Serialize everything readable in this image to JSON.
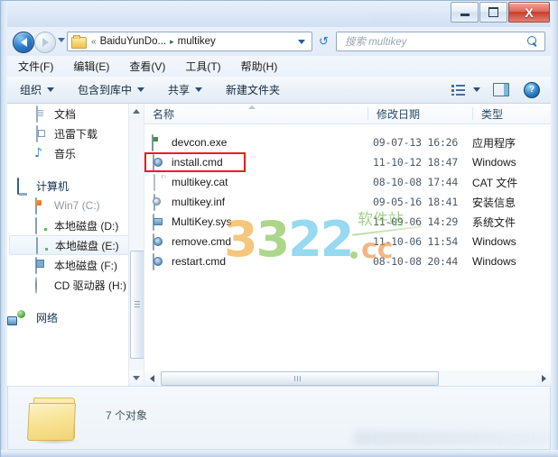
{
  "window": {
    "titlebar": {
      "minimize_label": "—",
      "maximize_label": "",
      "close_label": "X"
    }
  },
  "address_bar": {
    "folder_icon": "folder-icon",
    "overflow_chevron": "«",
    "crumbs": [
      "BaiduYunDo...",
      "multikey"
    ],
    "separator": "▸",
    "dropdown_icon": "chevron-down-icon",
    "refresh_icon": "refresh-icon",
    "back_icon": "back-arrow-icon",
    "forward_icon": "forward-arrow-icon"
  },
  "search": {
    "placeholder": "搜索 multikey",
    "icon": "search-icon"
  },
  "menubar": {
    "items": [
      {
        "label": "文件(F)"
      },
      {
        "label": "编辑(E)"
      },
      {
        "label": "查看(V)"
      },
      {
        "label": "工具(T)"
      },
      {
        "label": "帮助(H)"
      }
    ]
  },
  "commandbar": {
    "items": [
      {
        "label": "组织",
        "has_caret": true
      },
      {
        "label": "包含到库中",
        "has_caret": true
      },
      {
        "label": "共享",
        "has_caret": true
      },
      {
        "label": "新建文件夹",
        "has_caret": false
      }
    ],
    "views_icon": "view-layout-icon",
    "views_caret": "chevron-down-icon",
    "preview_pane_icon": "preview-pane-icon",
    "help_icon": "help-icon",
    "help_glyph": "?"
  },
  "navpane": {
    "groups": [
      {
        "items": [
          {
            "label": "文档",
            "icon": "document-icon",
            "state": "normal"
          },
          {
            "label": "迅雷下载",
            "icon": "download-folder-icon",
            "state": "normal"
          },
          {
            "label": "音乐",
            "icon": "music-icon",
            "state": "normal"
          }
        ]
      },
      {
        "root": {
          "label": "计算机",
          "icon": "computer-icon"
        },
        "items": [
          {
            "label": "Win7 (C:)",
            "icon": "windows-drive-icon",
            "state": "dim"
          },
          {
            "label": "本地磁盘 (D:)",
            "icon": "drive-icon",
            "state": "normal"
          },
          {
            "label": "本地磁盘 (E:)",
            "icon": "drive-icon",
            "state": "selected"
          },
          {
            "label": "本地磁盘 (F:)",
            "icon": "drive-icon",
            "state": "normal"
          },
          {
            "label": "CD 驱动器 (H:)",
            "icon": "cd-drive-icon",
            "state": "normal"
          }
        ]
      },
      {
        "root": {
          "label": "网络",
          "icon": "network-icon"
        },
        "items": []
      }
    ]
  },
  "filelist": {
    "columns": [
      {
        "label": "名称",
        "sorted": true,
        "sort_dir": "asc"
      },
      {
        "label": "修改日期",
        "sorted": false
      },
      {
        "label": "类型",
        "sorted": false
      }
    ],
    "rows": [
      {
        "name": "devcon.exe",
        "date": "09-07-13 16:26",
        "type": "应用程序",
        "icon": "exe-file-icon",
        "highlighted": false
      },
      {
        "name": "install.cmd",
        "date": "11-10-12 18:47",
        "type": "Windows",
        "icon": "cmd-file-icon",
        "highlighted": true
      },
      {
        "name": "multikey.cat",
        "date": "08-10-08 17:44",
        "type": "CAT 文件",
        "icon": "blank-file-icon",
        "highlighted": false
      },
      {
        "name": "multikey.inf",
        "date": "09-05-16 18:41",
        "type": "安装信息",
        "icon": "inf-file-icon",
        "highlighted": false
      },
      {
        "name": "MultiKey.sys",
        "date": "11-09-06 14:29",
        "type": "系统文件",
        "icon": "sys-file-icon",
        "highlighted": false
      },
      {
        "name": "remove.cmd",
        "date": "11-10-06 11:54",
        "type": "Windows",
        "icon": "cmd-file-icon",
        "highlighted": false
      },
      {
        "name": "restart.cmd",
        "date": "08-10-08 20:44",
        "type": "Windows",
        "icon": "cmd-file-icon",
        "highlighted": false
      }
    ]
  },
  "watermark": {
    "digits": "3322",
    "tld": "cc",
    "dot": ".",
    "text": "软件站"
  },
  "statusbar": {
    "folder_icon": "folder-icon",
    "count_label": "7 个对象"
  },
  "colors": {
    "highlight_red": "#ee1b1b",
    "accent_blue": "#2b7fd0",
    "folder_yellow": "#f8e294",
    "close_red": "#c83c2c"
  }
}
